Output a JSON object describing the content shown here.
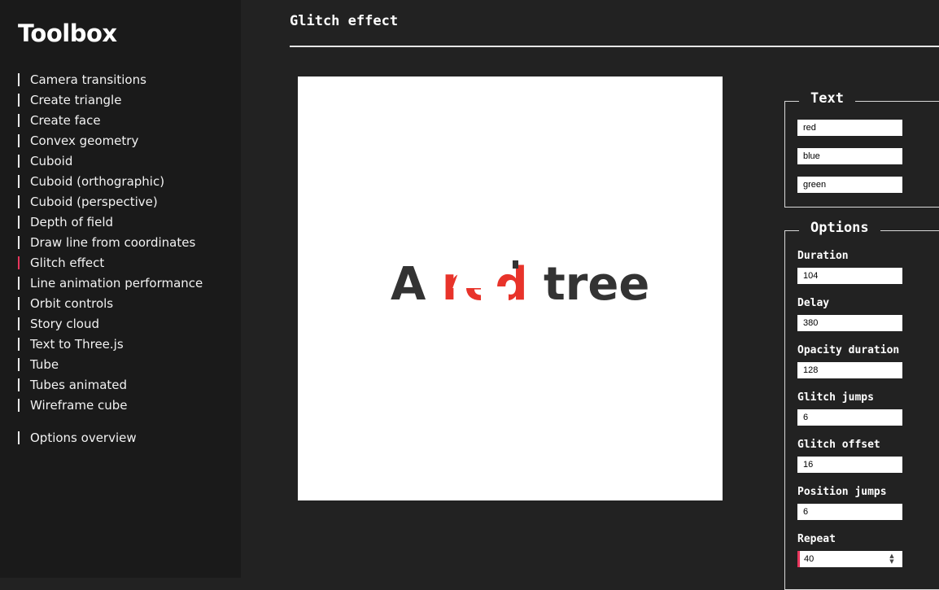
{
  "sidebar": {
    "brand": "Toolbox",
    "items": [
      {
        "label": "Camera transitions"
      },
      {
        "label": "Create triangle"
      },
      {
        "label": "Create face"
      },
      {
        "label": "Convex geometry"
      },
      {
        "label": "Cuboid"
      },
      {
        "label": "Cuboid (orthographic)"
      },
      {
        "label": "Cuboid (perspective)"
      },
      {
        "label": "Depth of field"
      },
      {
        "label": "Draw line from coordinates"
      },
      {
        "label": "Glitch effect"
      },
      {
        "label": "Line animation performance"
      },
      {
        "label": "Orbit controls"
      },
      {
        "label": "Story cloud"
      },
      {
        "label": "Text to Three.js"
      },
      {
        "label": "Tube"
      },
      {
        "label": "Tubes animated"
      },
      {
        "label": "Wireframe cube"
      }
    ],
    "footer_item": "Options overview",
    "active_item": "Glitch effect",
    "accent_color": "#e8365d"
  },
  "main": {
    "title": "Glitch effect",
    "canvas": {
      "text_first": "A",
      "text_red": "red",
      "text_last": "tree",
      "red_color": "#e8332a"
    }
  },
  "text_panel": {
    "legend": "Text",
    "fields": [
      "red",
      "blue",
      "green"
    ]
  },
  "options_panel": {
    "legend": "Options",
    "fields": [
      {
        "label": "Duration",
        "value": "104"
      },
      {
        "label": "Delay",
        "value": "380"
      },
      {
        "label": "Opacity duration",
        "value": "128"
      },
      {
        "label": "Glitch jumps",
        "value": "6"
      },
      {
        "label": "Glitch offset",
        "value": "16"
      },
      {
        "label": "Position jumps",
        "value": "6"
      },
      {
        "label": "Repeat",
        "value": "40"
      }
    ]
  }
}
